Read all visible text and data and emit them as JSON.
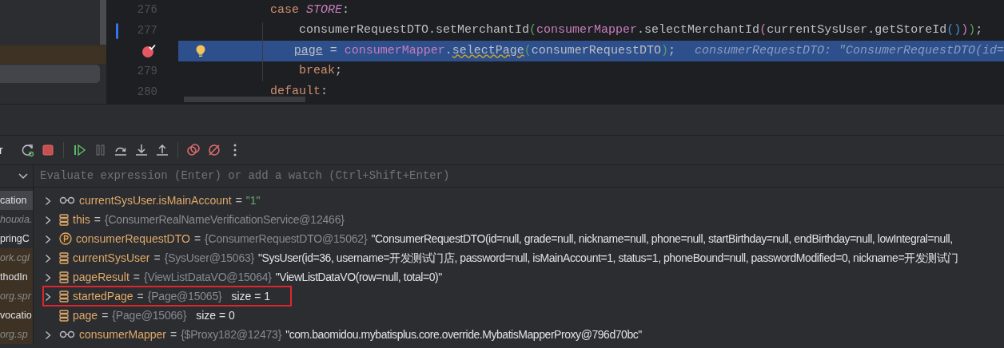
{
  "editor": {
    "lines": [
      {
        "number": "276",
        "kind": "label",
        "changed": false,
        "current": false,
        "breakpoint": false,
        "tokens": [
          {
            "text": "case ",
            "kind": "keyword"
          },
          {
            "text": "STORE",
            "kind": "constant"
          },
          {
            "text": ":",
            "kind": "plain"
          }
        ]
      },
      {
        "number": "277",
        "kind": "statement",
        "changed": true,
        "current": false,
        "breakpoint": false,
        "tokens": [
          {
            "text": "consumerRequestDTO.setMerchantId",
            "kind": "plain"
          },
          {
            "text": "(",
            "kind": "paren1"
          },
          {
            "text": "consumerMapper",
            "kind": "field"
          },
          {
            "text": ".selectMerchantId",
            "kind": "plain"
          },
          {
            "text": "(",
            "kind": "paren2"
          },
          {
            "text": "currentSysUser.getStoreId",
            "kind": "plain"
          },
          {
            "text": "()",
            "kind": "paren3"
          },
          {
            "text": ")",
            "kind": "paren2"
          },
          {
            "text": ")",
            "kind": "paren1"
          },
          {
            "text": ";",
            "kind": "plain"
          }
        ]
      },
      {
        "kind": "statement",
        "changed": false,
        "current": true,
        "breakpoint": true,
        "tokens": [
          {
            "text": "page",
            "kind": "underlined"
          },
          {
            "text": " = ",
            "kind": "plain"
          },
          {
            "text": "consumerMapper",
            "kind": "field"
          },
          {
            "text": ".",
            "kind": "plain"
          },
          {
            "text": "selectPage",
            "kind": "warning"
          },
          {
            "text": "(",
            "kind": "paren1"
          },
          {
            "text": "consumerRequestDTO",
            "kind": "plain"
          },
          {
            "text": ")",
            "kind": "paren1"
          },
          {
            "text": ";",
            "kind": "plain"
          }
        ],
        "hint": "consumerRequestDTO: \"ConsumerRequestDTO(id="
      },
      {
        "number": "279",
        "kind": "statement",
        "changed": false,
        "current": false,
        "breakpoint": false,
        "tokens": [
          {
            "text": "break",
            "kind": "keyword"
          },
          {
            "text": ";",
            "kind": "plain"
          }
        ]
      },
      {
        "number": "280",
        "kind": "label",
        "changed": false,
        "current": false,
        "breakpoint": false,
        "tokens": [
          {
            "text": "default",
            "kind": "keyword"
          },
          {
            "text": ":",
            "kind": "plain"
          }
        ]
      }
    ]
  },
  "toolbar": {
    "label": "r"
  },
  "watch_field": {
    "placeholder": "Evaluate expression (Enter) or add a watch (Ctrl+Shift+Enter)"
  },
  "frames": [
    {
      "text": "cation",
      "selected": true,
      "kind": "app",
      "external": false
    },
    {
      "text": "houxia.",
      "selected": false,
      "kind": "library",
      "external": false
    },
    {
      "text": "pringC",
      "selected": false,
      "kind": "app",
      "external": false
    },
    {
      "text": "ork.cgl",
      "selected": false,
      "kind": "library",
      "external": true
    },
    {
      "text": "thodIn",
      "selected": false,
      "kind": "app",
      "external": true
    },
    {
      "text": "org.spr",
      "selected": false,
      "kind": "library",
      "external": true
    },
    {
      "text": "vocatio",
      "selected": false,
      "kind": "app",
      "external": true
    },
    {
      "text": "org.sp",
      "selected": false,
      "kind": "library",
      "external": true
    }
  ],
  "variables": [
    {
      "kind": "watch",
      "expandable": true,
      "highlighted": false,
      "name": "currentSysUser.isMainAccount",
      "operator": "=",
      "string": "\"1\""
    },
    {
      "kind": "field",
      "expandable": true,
      "highlighted": false,
      "name": "this",
      "operator": "=",
      "type": "{ConsumerRealNameVerificationService@12466}"
    },
    {
      "kind": "parameter",
      "expandable": true,
      "highlighted": false,
      "name": "consumerRequestDTO",
      "operator": "=",
      "type": "{ConsumerRequestDTO@15062}",
      "value": "\"ConsumerRequestDTO(id=null, grade=null, nickname=null, phone=null, startBirthday=null, endBirthday=null, lowIntegral=null,"
    },
    {
      "kind": "field",
      "expandable": true,
      "highlighted": false,
      "name": "currentSysUser",
      "operator": "=",
      "type": "{SysUser@15063}",
      "value": "\"SysUser(id=36, username=开发测试门店, password=null, isMainAccount=1, status=1, phoneBound=null, passwordModified=0, nickname=开发测试门"
    },
    {
      "kind": "field",
      "expandable": true,
      "highlighted": false,
      "name": "pageResult",
      "operator": "=",
      "type": "{ViewListDataVO@15064}",
      "value": "\"ViewListDataVO(row=null, total=0)\""
    },
    {
      "kind": "field",
      "expandable": true,
      "highlighted": true,
      "name": "startedPage",
      "operator": "=",
      "type": "{Page@15065}",
      "size": "size = 1"
    },
    {
      "kind": "field",
      "expandable": false,
      "highlighted": false,
      "name": "page",
      "operator": "=",
      "type": "{Page@15066}",
      "size": "size = 0"
    },
    {
      "kind": "watch",
      "expandable": true,
      "highlighted": false,
      "name": "consumerMapper",
      "operator": "=",
      "type": "{$Proxy182@12473}",
      "value": "\"com.baomidou.mybatisplus.core.override.MybatisMapperProxy@796d70bc\""
    }
  ]
}
